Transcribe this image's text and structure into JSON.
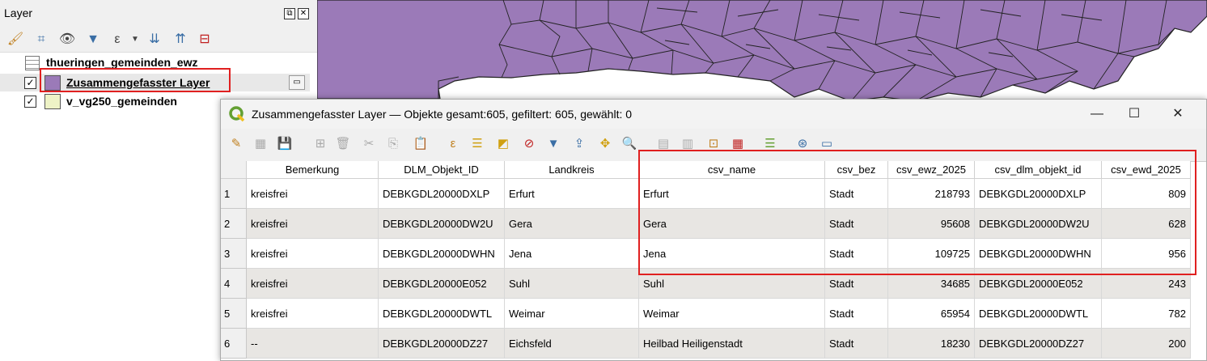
{
  "layer_panel": {
    "title": "Layer",
    "layers": [
      {
        "name": "thueringen_gemeinden_ewz",
        "type": "table"
      },
      {
        "name": "Zusammengefasster Layer",
        "checked": true,
        "swatch_color": "#9b7ab8"
      },
      {
        "name": "v_vg250_gemeinden",
        "checked": true,
        "swatch_color": "#eef3c6"
      }
    ]
  },
  "map": {
    "fill_color": "#9b7ab8",
    "stroke_color": "#222222"
  },
  "attribute_window": {
    "title": "Zusammengefasster Layer — Objekte gesamt:605, gefiltert: 605, gewählt: 0",
    "columns": [
      "Bemerkung",
      "DLM_Objekt_ID",
      "Landkreis",
      "csv_name",
      "csv_bez",
      "csv_ewz_2025",
      "csv_dlm_objekt_id",
      "csv_ewd_2025"
    ],
    "rows": [
      [
        "1",
        "kreisfrei",
        "DEBKGDL20000DXLP",
        "Erfurt",
        "Erfurt",
        "Stadt",
        "218793",
        "DEBKGDL20000DXLP",
        "809"
      ],
      [
        "2",
        "kreisfrei",
        "DEBKGDL20000DW2U",
        "Gera",
        "Gera",
        "Stadt",
        "95608",
        "DEBKGDL20000DW2U",
        "628"
      ],
      [
        "3",
        "kreisfrei",
        "DEBKGDL20000DWHN",
        "Jena",
        "Jena",
        "Stadt",
        "109725",
        "DEBKGDL20000DWHN",
        "956"
      ],
      [
        "4",
        "kreisfrei",
        "DEBKGDL20000E052",
        "Suhl",
        "Suhl",
        "Stadt",
        "34685",
        "DEBKGDL20000E052",
        "243"
      ],
      [
        "5",
        "kreisfrei",
        "DEBKGDL20000DWTL",
        "Weimar",
        "Weimar",
        "Stadt",
        "65954",
        "DEBKGDL20000DWTL",
        "782"
      ],
      [
        "6",
        "--",
        "DEBKGDL20000DZ27",
        "Eichsfeld",
        "Heilbad Heiligenstadt",
        "Stadt",
        "18230",
        "DEBKGDL20000DZ27",
        "200"
      ]
    ]
  },
  "colors": {
    "highlight_box": "#e02020",
    "qgis_green": "#64a032"
  }
}
